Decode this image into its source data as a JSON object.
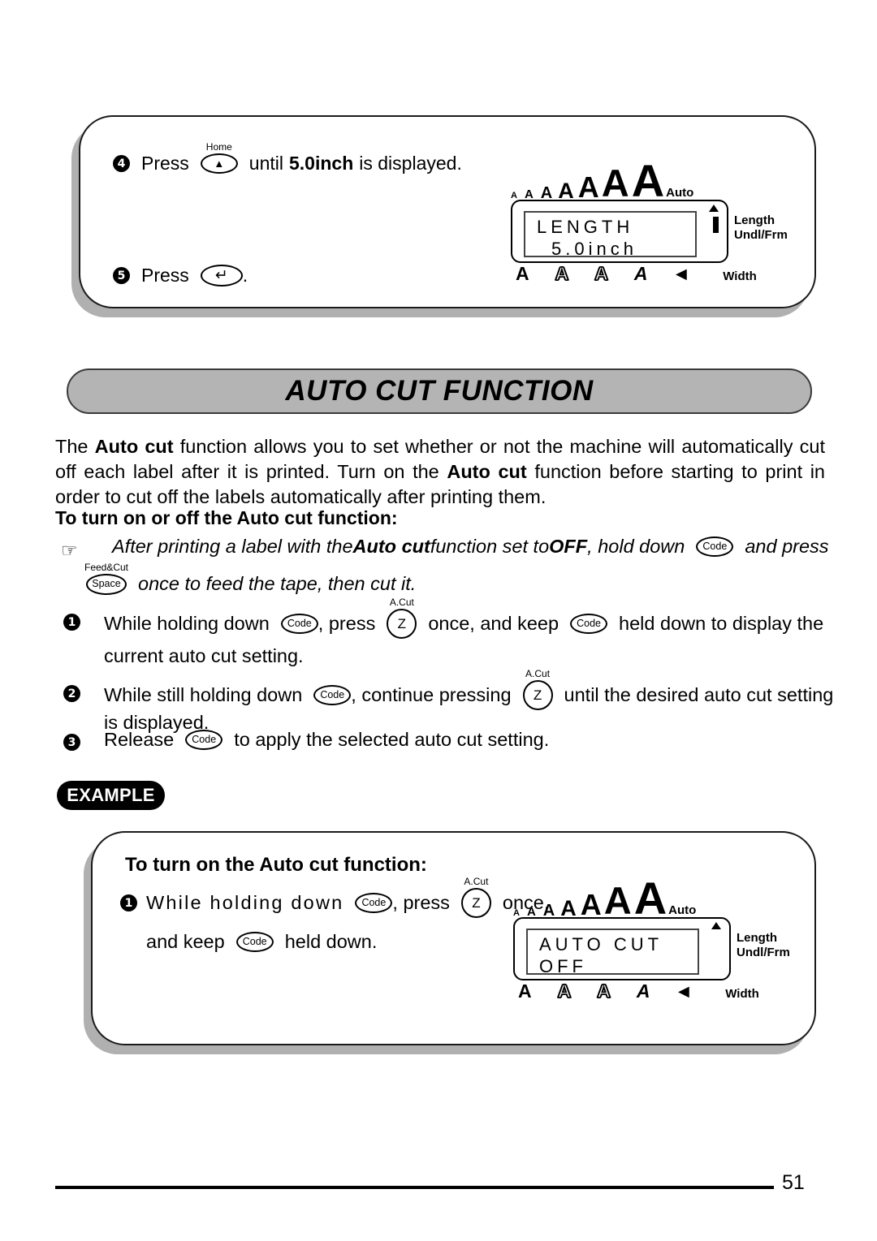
{
  "page": {
    "number": "51"
  },
  "top_panel": {
    "step4": {
      "badge": "4",
      "press_label": "Press",
      "key": {
        "label": "Home",
        "glyph": "▲",
        "name": "home-up-key"
      },
      "text_after": "until",
      "bold_value": "5.0inch",
      "text_end": "is displayed."
    },
    "step5": {
      "badge": "5",
      "press_label": "Press",
      "key": {
        "glyph": "↵",
        "name": "enter-key"
      },
      "period": "."
    },
    "lcd": {
      "auto_label": "Auto",
      "line1": "LENGTH",
      "line2": "5.0inch",
      "right_labels": [
        "Length",
        "Undl/Frm"
      ],
      "width_label": "Width",
      "has_length_bar": true,
      "size_scale": [
        "A",
        "A",
        "A",
        "A",
        "A",
        "A",
        "A"
      ],
      "bottom_indicators": [
        "A",
        "A",
        "A",
        "A",
        "◄"
      ]
    }
  },
  "title": {
    "heading": "AUTO CUT FUNCTION"
  },
  "intro": {
    "p1_a": "The ",
    "p1_b": "Auto cut",
    "p1_c": " function allows you to set whether or not the machine will automatically cut off each label after it is printed. Turn on the ",
    "p1_d": "Auto cut",
    "p1_e": " function before starting to print in order to cut off the labels automatically after printing them."
  },
  "subhead": {
    "text": "To turn on or off the Auto cut function:"
  },
  "note": {
    "icon": "☞",
    "line1_a": "After printing a label with the ",
    "line1_b": "Auto cut",
    "line1_c": " function set to ",
    "line1_d": "OFF",
    "line1_e": ", hold down",
    "code_key": "Code",
    "line1_f": "and press",
    "space_key": {
      "label": "Feed&Cut",
      "text": "Space"
    },
    "line2": "once to feed the tape, then cut it."
  },
  "steps": [
    {
      "badge": "1",
      "t1": "While holding down",
      "code_key": "Code",
      "t2": ", press",
      "z_key": {
        "label": "A.Cut",
        "text": "Z"
      },
      "t3": "once, and keep",
      "code_key2": "Code",
      "t4": "held down to display the",
      "cont": "current auto cut setting."
    },
    {
      "badge": "2",
      "t1": "While still holding down",
      "code_key": "Code",
      "t2": ", continue pressing",
      "z_key": {
        "label": "A.Cut",
        "text": "Z"
      },
      "t3": "until the desired auto cut setting",
      "cont": "is displayed."
    },
    {
      "badge": "3",
      "t1": "Release",
      "code_key": "Code",
      "t2": "to apply the selected auto cut setting."
    }
  ],
  "example": {
    "badge_label": "EXAMPLE",
    "heading": "To turn on the Auto cut function:",
    "step": {
      "badge": "1",
      "t1": "While  holding  down",
      "code_key": "Code",
      "t2": ",  press",
      "z_key": {
        "label": "A.Cut",
        "text": "Z"
      },
      "t3": "once,",
      "cont_a": "and keep",
      "code_key2": "Code",
      "cont_b": "held down."
    },
    "lcd": {
      "auto_label": "Auto",
      "line1": "AUTO  CUT",
      "line2": "OFF",
      "right_labels": [
        "Length",
        "Undl/Frm"
      ],
      "width_label": "Width",
      "has_length_bar": false,
      "size_scale": [
        "A",
        "A",
        "A",
        "A",
        "A",
        "A",
        "A"
      ],
      "bottom_indicators": [
        "A",
        "A",
        "A",
        "A",
        "◄"
      ]
    }
  },
  "colors": {
    "banner_fill": "#b4b4b4",
    "shadow": "#b0b0b0",
    "ink": "#000000"
  }
}
